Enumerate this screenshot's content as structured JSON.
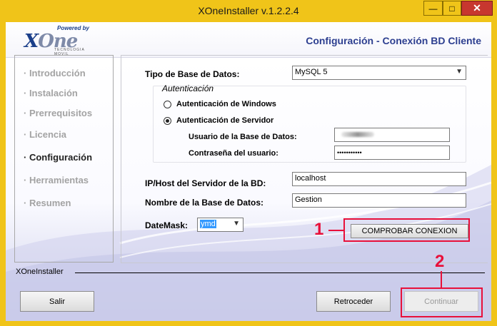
{
  "window": {
    "title": "XOneInstaller v.1.2.2.4",
    "min_glyph": "—",
    "max_glyph": "□",
    "close_glyph": "✕"
  },
  "header": {
    "logo_small": "Powered by",
    "logo_x": "X",
    "logo_rest": "One",
    "logo_tag": "TECNOLOGIA MOVIL",
    "page_heading": "Configuración - Conexión BD Cliente"
  },
  "nav": {
    "items": [
      {
        "label": "· Introducción",
        "active": false
      },
      {
        "label": "· Instalación",
        "active": false
      },
      {
        "label": "· Prerrequisitos",
        "active": false
      },
      {
        "label": "· Licencia",
        "active": false
      },
      {
        "label": "· Configuración",
        "active": true
      },
      {
        "label": "· Herramientas",
        "active": false
      },
      {
        "label": "· Resumen",
        "active": false
      }
    ]
  },
  "form": {
    "db_type_label": "Tipo de Base de Datos:",
    "db_type_value": "MySQL 5",
    "auth_group_label": "Autenticación",
    "auth_windows_label": "Autenticación de Windows",
    "auth_server_label": "Autenticación de Servidor",
    "auth_selected": "server",
    "db_user_label": "Usuario de la Base de Datos:",
    "db_password_label": "Contraseña del usuario:",
    "db_password_value": "•••••••••••",
    "host_label": "IP/Host del Servidor de la BD:",
    "host_value": "localhost",
    "db_name_label": "Nombre de la Base de Datos:",
    "db_name_value": "Gestion",
    "datemask_label": "DateMask:",
    "datemask_value": "ymd",
    "test_button": "COMPROBAR CONEXION"
  },
  "footer": {
    "label": "XOneInstaller",
    "exit_button": "Salir",
    "back_button": "Retroceder",
    "continue_button": "Continuar",
    "continue_enabled": false
  },
  "annotations": {
    "step1": "1",
    "step2": "2",
    "color": "#e8103a"
  },
  "colors": {
    "window_frame": "#f0c419",
    "heading": "#2d3f90",
    "nav_active": "#222222",
    "nav_inactive": "#a3a3a3"
  }
}
